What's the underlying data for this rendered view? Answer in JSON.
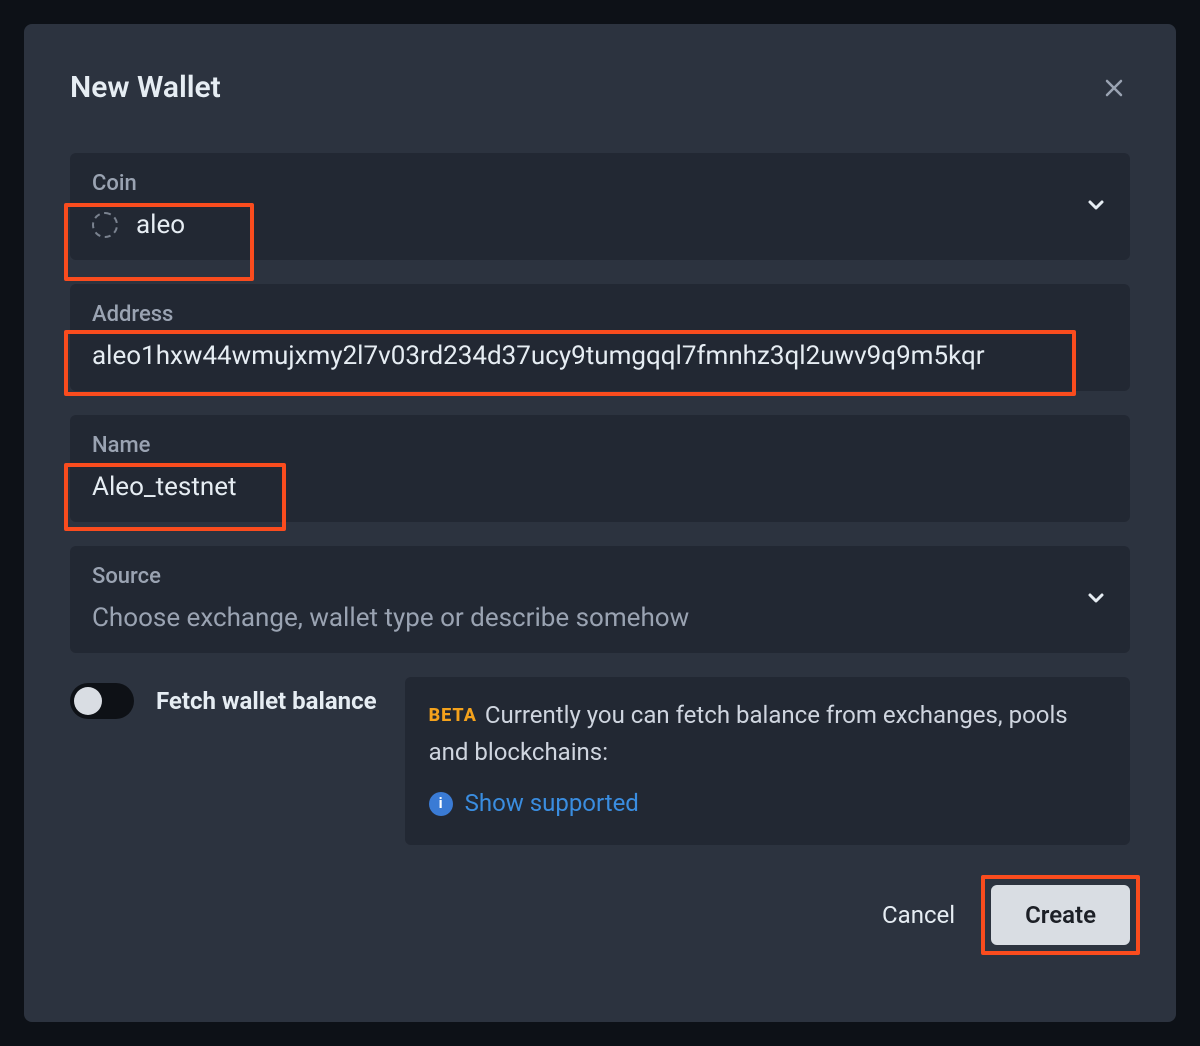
{
  "modal": {
    "title": "New Wallet",
    "fields": {
      "coin": {
        "label": "Coin",
        "value": "aleo"
      },
      "address": {
        "label": "Address",
        "value": "aleo1hxw44wmujxmy2l7v03rd234d37ucy9tumgqql7fmnhz3ql2uwv9q9m5kqr"
      },
      "name": {
        "label": "Name",
        "value": "Aleo_testnet"
      },
      "source": {
        "label": "Source",
        "placeholder": "Choose exchange, wallet type or describe somehow"
      }
    },
    "toggle": {
      "label": "Fetch wallet balance",
      "on": false
    },
    "beta": {
      "tag": "BETA",
      "text": "Currently you can fetch balance from exchanges, pools and blockchains:",
      "link": "Show supported"
    },
    "buttons": {
      "cancel": "Cancel",
      "create": "Create"
    }
  }
}
